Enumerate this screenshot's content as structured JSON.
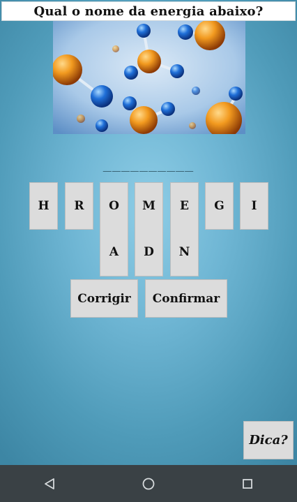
{
  "question": "Qual o nome da energia abaixo?",
  "image": {
    "subject": "molecule-illustration"
  },
  "answer": {
    "slots": "__________",
    "length": 10
  },
  "letters_row1": [
    "H",
    "R",
    "O",
    "M",
    "E",
    "G",
    "I"
  ],
  "letters_row2": [
    "A",
    "D",
    "N"
  ],
  "buttons": {
    "corrigir": "Corrigir",
    "confirmar": "Confirmar",
    "dica": "Dica?"
  },
  "navigation": [
    "back-icon",
    "home-icon",
    "recents-icon"
  ],
  "colors": {
    "tile": "#dcdcdc",
    "background": "#6fb6d4",
    "navbar": "#3a4145"
  }
}
